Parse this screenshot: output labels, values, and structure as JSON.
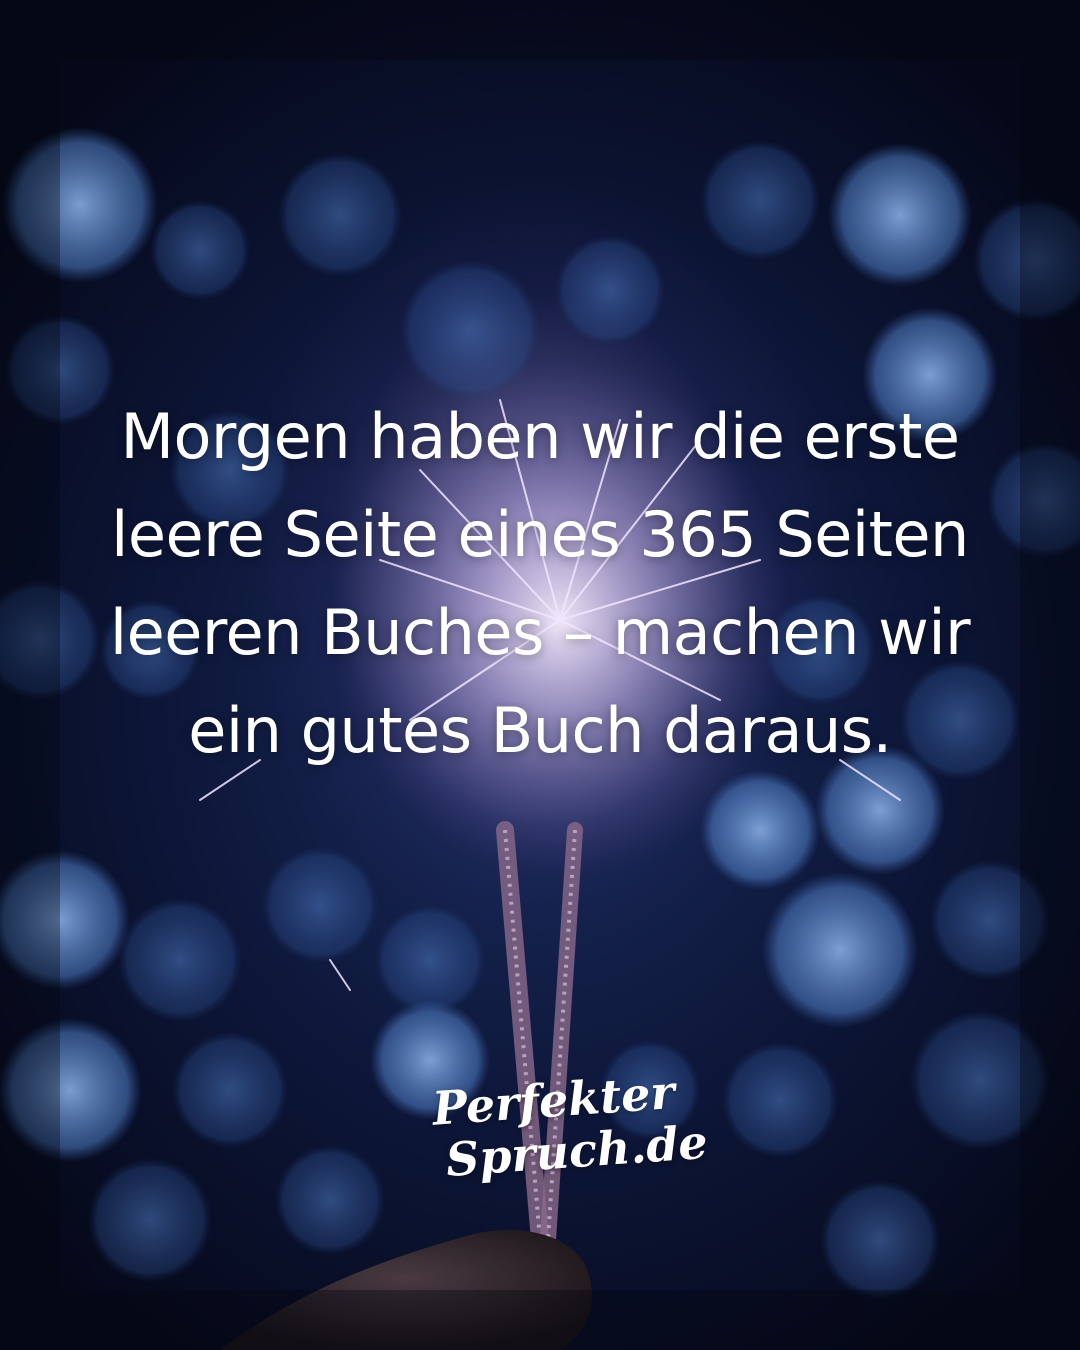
{
  "quote": {
    "lines": [
      "Morgen haben wir die erste",
      "leere Seite eines 365 Seiten",
      "leeren Buches – machen wir",
      "ein gutes Buch daraus."
    ]
  },
  "logo": {
    "line1": "Perfekter",
    "line2": "Spruch.de"
  },
  "colors": {
    "text": "#ffffff",
    "bokeh": "#5b8fd6",
    "background": "#0d1638"
  }
}
